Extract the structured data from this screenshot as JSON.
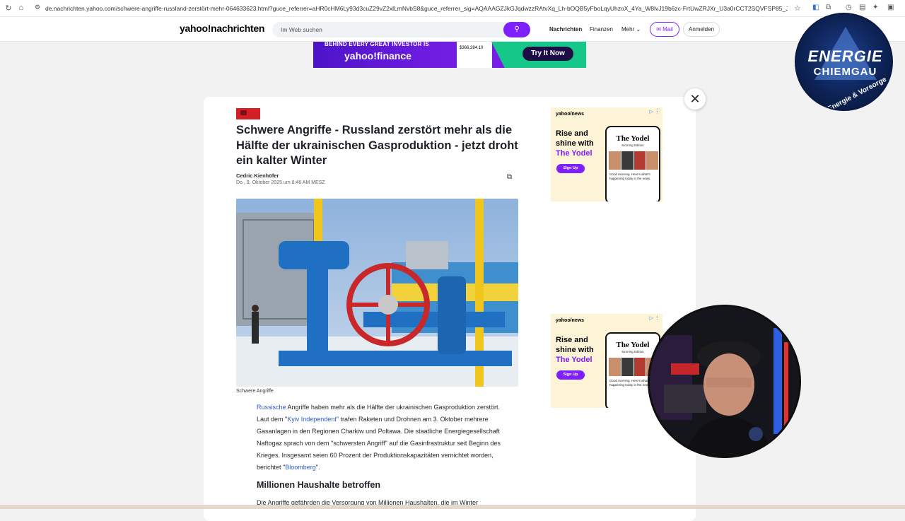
{
  "browser": {
    "url": "de.nachrichten.yahoo.com/schwere-angriffe-russland-zerstört-mehr-064633623.html?guce_referrer=aHR0cHM6Ly93d3cuZ29vZ2xlLmNvbS8&guce_referrer_sig=AQAAAGZJkGJqdwzzRAtvXq_Lh-bOQB5yFboLqyUhzoX_4Ya_W8lvJ19b6zc-FrtUwZRJXr_U3a0rCCT2SQVFSP85_JyI77kP71GsW83IcUiOpH_BzjK6D5RZV5csRx8sIdDG..."
  },
  "nav": {
    "logo_prefix": "yahoo!",
    "logo_suffix": "nachrichten",
    "search_placeholder": "Im Web suchen",
    "links": [
      "Nachrichten",
      "Finanzen",
      "Mehr"
    ],
    "mail_label": "Mail",
    "login_label": "Anmelden"
  },
  "top_ad": {
    "tagline": "BEHIND EVERY GREAT INVESTOR IS",
    "brand": "yahoo!finance",
    "amount": "$366,284.10",
    "cta": "Try It Now"
  },
  "article": {
    "headline": "Schwere Angriffe - Russland zerstört mehr als die Hälfte der ukrainischen Gasproduktion - jetzt droht ein kalter Winter",
    "author": "Cedric Kienhöfer",
    "date": "Do., 9. Oktober 2025 um 8:46 AM MESZ",
    "caption": "Schwere Angriffe",
    "p1_link1": "Russische",
    "p1_a": " Angriffe haben mehr als die Hälfte der ukrainischen Gasproduktion zerstört. Laut dem \"",
    "p1_link2": "Kyiv Independent",
    "p1_b": "\" trafen Raketen und Drohnen am 3. Oktober mehrere Gasanlagen in den Regionen Charkiw und Poltawa. Die staatliche Energiegesellschaft Naftogaz sprach von dem \"schwersten Angriff\" auf die Gasinfrastruktur seit Beginn des Krieges. Insgesamt seien 60 Prozent der Produktionskapazitäten vernichtet worden, berichtet \"",
    "p1_link3": "Bloomberg",
    "p1_c": "\".",
    "subheading": "Millionen Haushalte betroffen",
    "p2": "Die Angriffe gefährden die Versorgung von Millionen Haushalten, die im Winter"
  },
  "side_ad": {
    "brand": "yahoo/news",
    "headline_a": "Rise and shine with",
    "headline_b": "The Yodel",
    "cta": "Sign Up",
    "phone_title": "The Yodel",
    "phone_sub": "Morning Edition",
    "phone_text": "Good morning. Here's what's happening today in the news."
  },
  "overlay": {
    "line1": "ENERGIE",
    "line2": "CHIEMGAU",
    "line3": "Energie & Vorsorge"
  },
  "colors": {
    "yahoo_purple": "#7e1fff",
    "link_blue": "#2d59c9",
    "source_red": "#d21e26"
  }
}
